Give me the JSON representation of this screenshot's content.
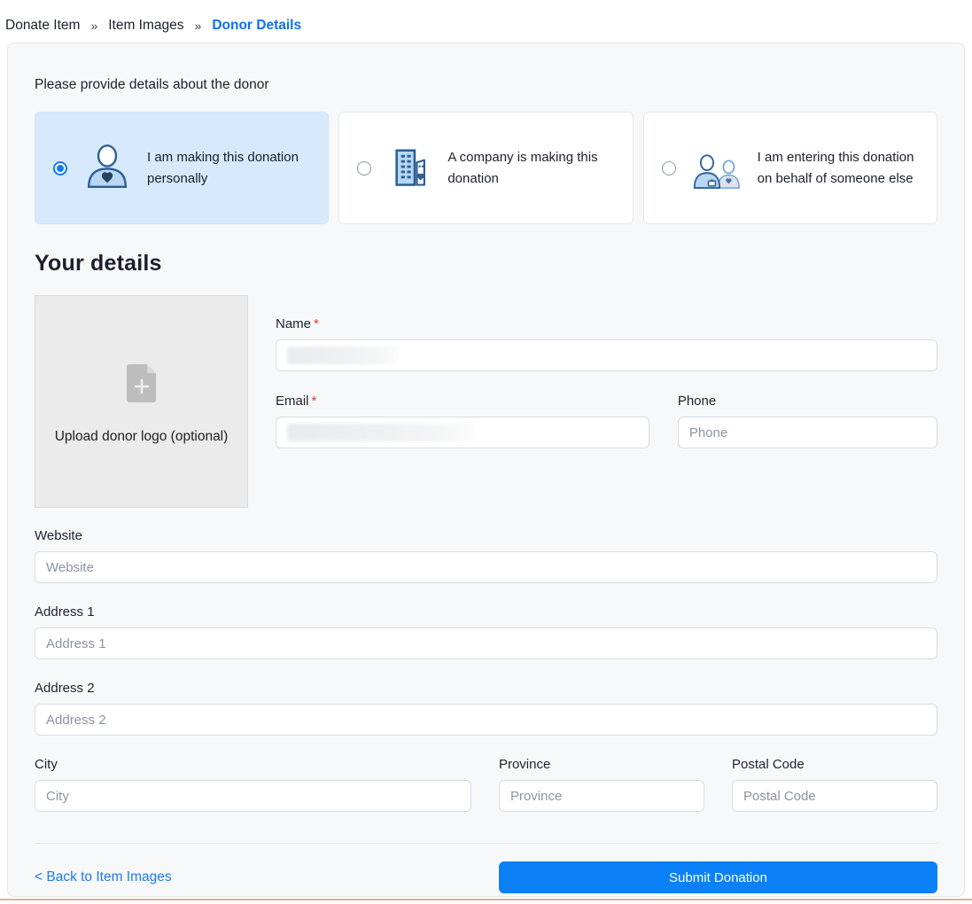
{
  "breadcrumb": {
    "separator": "»",
    "items": [
      {
        "label": "Donate Item"
      },
      {
        "label": "Item Images"
      },
      {
        "label": "Donor Details"
      }
    ]
  },
  "intro": "Please provide details about the donor",
  "donor_type_options": [
    {
      "label": "I am making this donation personally",
      "icon": "person-heart-icon",
      "selected": true
    },
    {
      "label": "A company is making this donation",
      "icon": "company-building-heart-icon",
      "selected": false
    },
    {
      "label": "I am entering this donation on behalf of someone else",
      "icon": "two-people-icon",
      "selected": false
    }
  ],
  "section_title": "Your details",
  "upload": {
    "label": "Upload donor logo (optional)",
    "icon": "file-plus-icon"
  },
  "fields": {
    "name": {
      "label": "Name",
      "required_marker": "*",
      "value_redacted": true
    },
    "email": {
      "label": "Email",
      "required_marker": "*",
      "value_redacted": true
    },
    "phone": {
      "label": "Phone",
      "placeholder": "Phone"
    },
    "website": {
      "label": "Website",
      "placeholder": "Website"
    },
    "address1": {
      "label": "Address 1",
      "placeholder": "Address 1"
    },
    "address2": {
      "label": "Address 2",
      "placeholder": "Address 2"
    },
    "city": {
      "label": "City",
      "placeholder": "City"
    },
    "province": {
      "label": "Province",
      "placeholder": "Province"
    },
    "postal_code": {
      "label": "Postal Code",
      "placeholder": "Postal Code"
    }
  },
  "footer": {
    "back_link": "< Back to Item Images",
    "submit_label": "Submit Donation"
  },
  "colors": {
    "accent_blue": "#0b80f7",
    "link_blue": "#1c79f3",
    "breadcrumb_active_blue": "#0c6ff2",
    "selected_card_bg": "#d7e9fc",
    "panel_bg": "#f7f8fa",
    "required_red": "#e8382f",
    "icon_navy": "#2d5e95",
    "icon_light_blue": "#b7d7f3",
    "upload_bg": "#ebebeb",
    "bottom_line_red": "#eaa9a2"
  }
}
